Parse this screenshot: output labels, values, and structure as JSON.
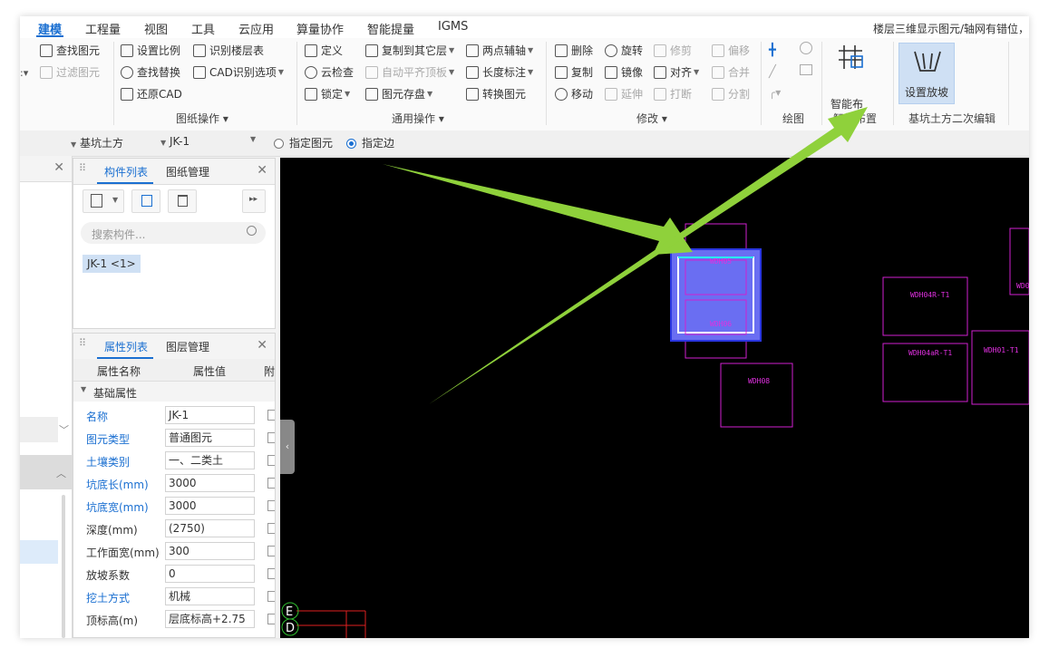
{
  "menu": {
    "tabs": [
      "建模",
      "工程量",
      "视图",
      "工具",
      "云应用",
      "算量协作",
      "智能提量",
      "IGMS"
    ],
    "right_text": "楼层三维显示图元/轴网有错位，"
  },
  "ribbon": {
    "col1": [
      "查找图元",
      "过滤图元"
    ],
    "col2": [
      "设置比例",
      "查找替换",
      "还原CAD"
    ],
    "col3": [
      "识别楼层表",
      "CAD识别选项"
    ],
    "col4": [
      "定义",
      "云检查",
      "锁定"
    ],
    "col5": [
      "复制到其它层",
      "自动平齐顶板",
      "图元存盘"
    ],
    "col6": [
      "两点辅轴",
      "长度标注",
      "转换图元"
    ],
    "col7": [
      "删除",
      "复制",
      "移动"
    ],
    "col8": [
      "旋转",
      "镜像",
      "延伸"
    ],
    "col9": [
      "修剪",
      "对齐",
      "打断"
    ],
    "col10": [
      "偏移",
      "合并",
      "分割"
    ],
    "smart_button": "智能布",
    "set_slope_button": "设置放坡",
    "groups": [
      "图纸操作",
      "通用操作",
      "修改",
      "绘图",
      "智能布置",
      "基坑土方二次编辑"
    ]
  },
  "toolbar": {
    "type_select": "基坑土方",
    "component_select": "JK-1",
    "radio1": "指定图元",
    "radio2": "指定边"
  },
  "comp_panel": {
    "tab_list": "构件列表",
    "tab_drawing": "图纸管理",
    "search_placeholder": "搜索构件...",
    "item": "JK-1 <1>"
  },
  "prop_panel": {
    "tab_props": "属性列表",
    "tab_layers": "图层管理",
    "col_name": "属性名称",
    "col_value": "属性值",
    "col_extra": "附",
    "section": "基础属性",
    "rows": [
      {
        "name": "名称",
        "value": "JK-1"
      },
      {
        "name": "图元类型",
        "value": "普通图元"
      },
      {
        "name": "土壤类别",
        "value": "一、二类土"
      },
      {
        "name": "坑底长(mm)",
        "value": "3000"
      },
      {
        "name": "坑底宽(mm)",
        "value": "3000"
      },
      {
        "name": "深度(mm)",
        "value": "(2750)"
      },
      {
        "name": "工作面宽(mm)",
        "value": "300"
      },
      {
        "name": "放坡系数",
        "value": "0"
      },
      {
        "name": "挖土方式",
        "value": "机械"
      },
      {
        "name": "顶标高(m)",
        "value": "层底标高+2.75"
      }
    ]
  },
  "canvas": {
    "labels": [
      "WDH05",
      "WDH06",
      "WDH08",
      "WDH04R-T1",
      "WDH04aR-T1",
      "WDH01-T1",
      "WD0"
    ],
    "axis_e": "E",
    "axis_d": "D"
  },
  "colors": {
    "accent": "#1a6fd1",
    "arrow": "#8fd13b",
    "magenta": "#d020d0"
  }
}
